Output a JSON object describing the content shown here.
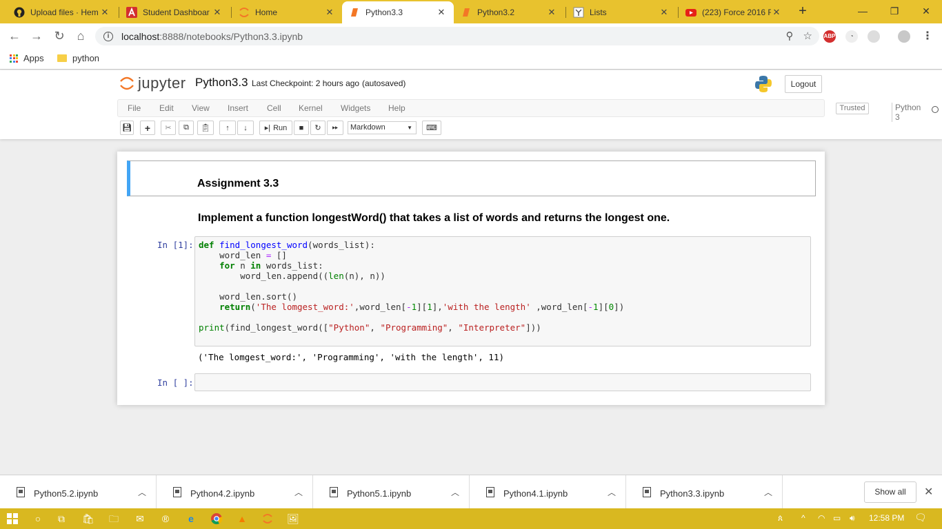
{
  "browser": {
    "tabs": [
      {
        "title": "Upload files · Hem",
        "icon": "github-icon",
        "active": false
      },
      {
        "title": "Student Dashboar",
        "icon": "dashboard-icon",
        "active": false
      },
      {
        "title": "Home",
        "icon": "jupyter-icon",
        "active": false
      },
      {
        "title": "Python3.3",
        "icon": "notebook-icon",
        "active": true
      },
      {
        "title": "Python3.2",
        "icon": "notebook-icon",
        "active": false
      },
      {
        "title": "Lists",
        "icon": "lists-icon",
        "active": false
      },
      {
        "title": "(223) Force 2016 F",
        "icon": "youtube-icon",
        "active": false
      }
    ],
    "url_host": "localhost",
    "url_path": ":8888/notebooks/Python3.3.ipynb",
    "bookmarks": [
      {
        "label": "Apps",
        "icon": "apps-grid-icon"
      },
      {
        "label": "python",
        "icon": "folder-icon"
      }
    ],
    "ext_abp": "ABP"
  },
  "jupyter": {
    "logo_text": "jupyter",
    "notebook_name": "Python3.3",
    "checkpoint": "Last Checkpoint: 2 hours ago",
    "autosave": "(autosaved)",
    "logout": "Logout",
    "menu": [
      "File",
      "Edit",
      "View",
      "Insert",
      "Cell",
      "Kernel",
      "Widgets",
      "Help"
    ],
    "trusted": "Trusted",
    "kernel": "Python 3",
    "run_label": "Run",
    "cell_type": "Markdown"
  },
  "notebook": {
    "title": "Assignment 3.3",
    "description": "Implement a function longestWord() that takes a list of words and returns the longest one.",
    "prompt_1": "In [1]:",
    "prompt_2": "In [ ]:",
    "code_lines": [
      "def find_longest_word(words_list):",
      "    word_len = []",
      "    for n in words_list:",
      "        word_len.append((len(n), n))",
      "",
      "    word_len.sort()",
      "    return('The lomgest_word:',word_len[-1][1],'with the length' ,word_len[-1][0])",
      "print(find_longest_word([\"Python\", \"Programming\", \"Interpreter\"]))"
    ],
    "output": "('The lomgest_word:', 'Programming', 'with the length', 11)"
  },
  "downloads": {
    "files": [
      "Python5.2.ipynb",
      "Python4.2.ipynb",
      "Python5.1.ipynb",
      "Python4.1.ipynb",
      "Python3.3.ipynb"
    ],
    "show_all": "Show all"
  },
  "taskbar": {
    "time": "12:58 PM"
  },
  "colors": {
    "tabstrip": "#e8c22e",
    "taskbar": "#d9b820",
    "md_cell_border": "#42a5f5",
    "prompt": "#303f9f"
  }
}
